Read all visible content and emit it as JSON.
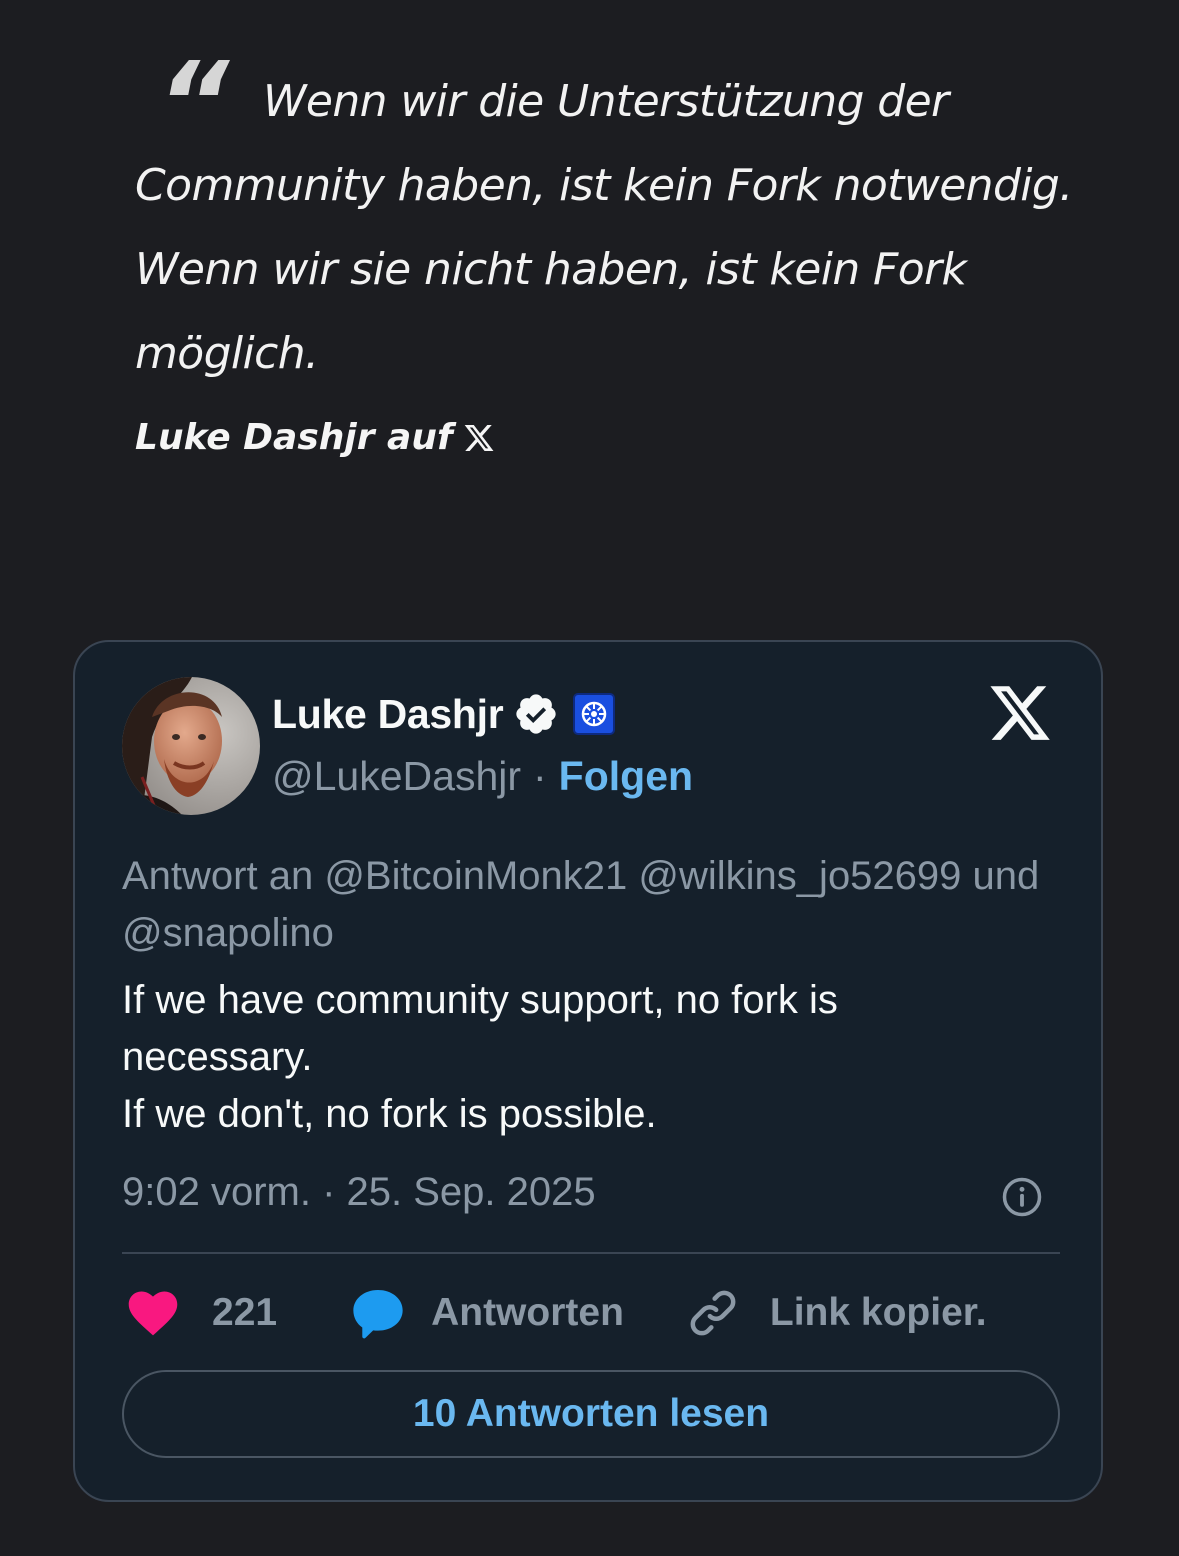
{
  "quote": {
    "mark": "“",
    "text": "Wenn wir die Unterstützung der Community haben, ist kein Fork notwendig. Wenn wir sie nicht haben, ist kein Fork möglich.",
    "source": "Luke Dashjr auf"
  },
  "tweet": {
    "display_name": "Luke Dashjr",
    "handle": "@LukeDashjr",
    "separator": "·",
    "follow_label": "Folgen",
    "reply_to": "Antwort an @BitcoinMonk21 @wilkins_jo52699 und @snapolino",
    "text_lines": [
      "If we have community support, no fork is",
      "necessary.",
      "If we don't, no fork is possible."
    ],
    "timestamp": "9:02 vorm. · 25. Sep. 2025",
    "actions": {
      "like_count": "221",
      "reply_label": "Antworten",
      "copy_link_label": "Link kopier."
    },
    "read_replies_label": "10 Antworten lesen"
  },
  "colors": {
    "page_background": "#1c1d21",
    "card_background": "#15202b",
    "accent_blue": "#6ab8f0",
    "like_pink": "#f91880",
    "reply_blue": "#1d9bf0",
    "muted_text": "#8b98a5"
  },
  "icons": {
    "quote": "quote-mark-icon",
    "x_brand": "x-logo-icon",
    "verified": "verified-badge-icon",
    "affiliate": "affiliate-badge-icon",
    "info": "info-icon",
    "like": "heart-icon",
    "reply": "speech-bubble-icon",
    "copy": "link-icon"
  }
}
